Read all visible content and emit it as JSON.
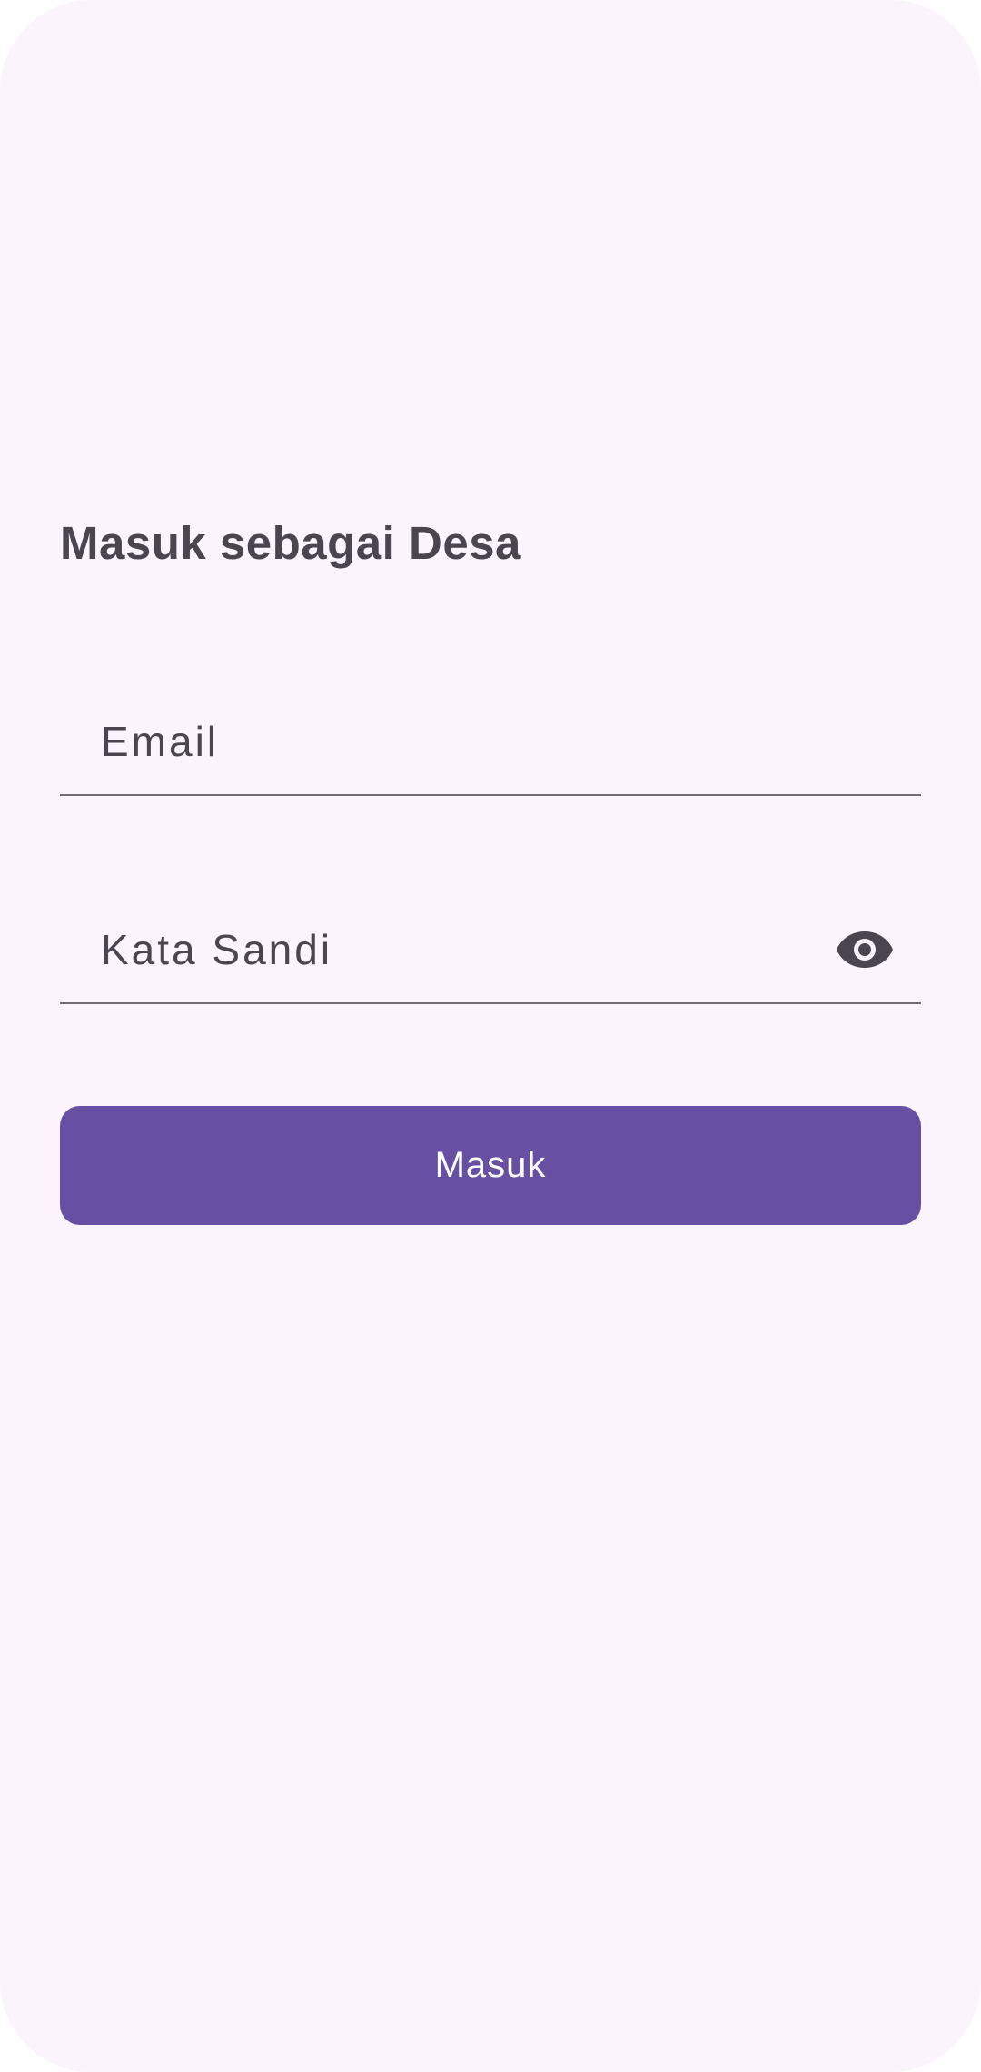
{
  "login": {
    "title": "Masuk sebagai Desa",
    "email_placeholder": "Email",
    "password_placeholder": "Kata Sandi",
    "password_toggle_icon": "eye-icon",
    "submit_label": "Masuk"
  },
  "colors": {
    "background": "#fcf4fc",
    "primary": "#6750a4",
    "text": "#4a454f",
    "underline": "#6f6a74"
  }
}
